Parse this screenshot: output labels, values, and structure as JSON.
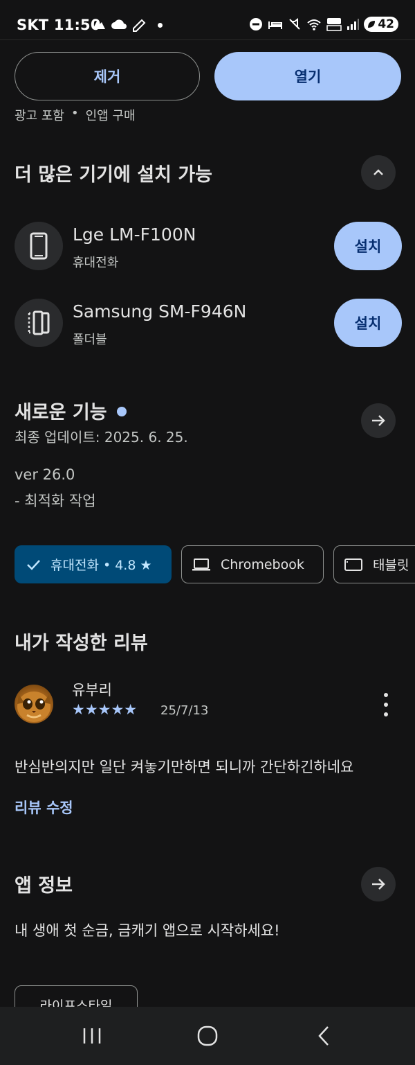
{
  "status_bar": {
    "time": "SKT 11:50",
    "battery": "42"
  },
  "actions": {
    "remove_label": "제거",
    "open_label": "열기"
  },
  "meta": {
    "ads": "광고 포함",
    "separator": "•",
    "iap": "인앱 구매"
  },
  "install_section": {
    "title": "더 많은 기기에 설치 가능",
    "devices": [
      {
        "name": "Lge LM-F100N",
        "type": "휴대전화",
        "install_label": "설치"
      },
      {
        "name": "Samsung SM-F946N",
        "type": "폴더블",
        "install_label": "설치"
      }
    ]
  },
  "whats_new": {
    "title": "새로운 기능",
    "updated": "최종 업데이트: 2025. 6. 25.",
    "version": "ver 26.0",
    "note": "- 최적화 작업"
  },
  "device_chips": {
    "phone": "휴대전화 • 4.8 ★",
    "chromebook": "Chromebook",
    "tablet": "태블릿"
  },
  "my_review": {
    "title": "내가 작성한 리뷰",
    "reviewer": "유부리",
    "rating": 5,
    "stars": "★★★★★",
    "date": "25/7/13",
    "text": "반심반의지만 일단 켜놓기만하면 되니까 간단하긴하네요",
    "edit_label": "리뷰 수정"
  },
  "app_info": {
    "title": "앱 정보",
    "description": "내 생애 첫 순금, 금캐기 앱으로 시작하세요!",
    "category": "라이프스타일"
  },
  "colors": {
    "background": "#131314",
    "accent": "#a8c7fa",
    "selected_chip": "#004a77"
  }
}
